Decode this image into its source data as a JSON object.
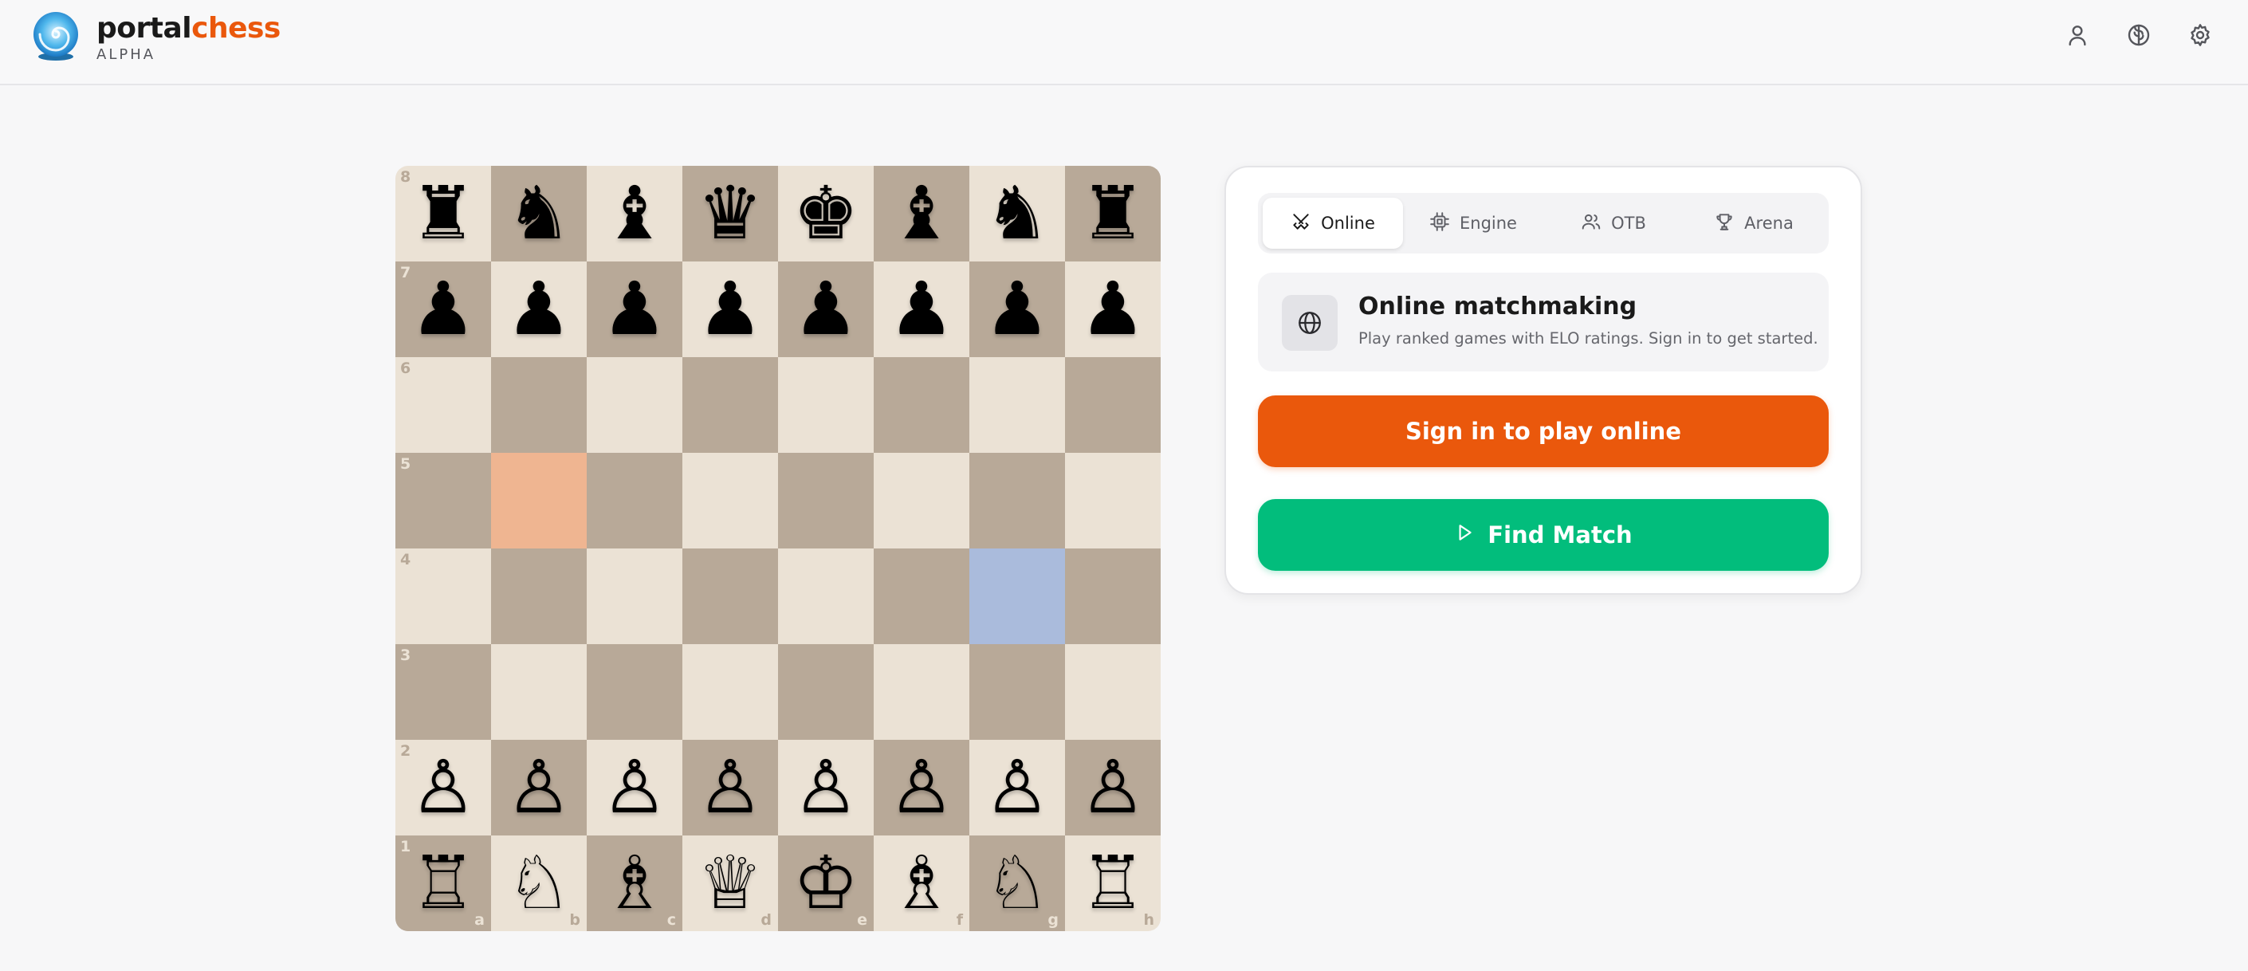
{
  "app": {
    "brand_part1": "portal",
    "brand_part2": "chess",
    "subtitle": "ALPHA",
    "logo_icon": "spiral-logo-icon",
    "accent_color": "#ea580c"
  },
  "header_icons": [
    {
      "name": "profile-icon"
    },
    {
      "name": "brain-icon"
    },
    {
      "name": "settings-icon"
    }
  ],
  "board": {
    "ranks": [
      "8",
      "7",
      "6",
      "5",
      "4",
      "3",
      "2",
      "1"
    ],
    "files": [
      "a",
      "b",
      "c",
      "d",
      "e",
      "f",
      "g",
      "h"
    ],
    "rows": [
      [
        "♜",
        "♞",
        "♝",
        "♛",
        "♚",
        "♝",
        "♞",
        "♜"
      ],
      [
        "♟",
        "♟",
        "♟",
        "♟",
        "♟",
        "♟",
        "♟",
        "♟"
      ],
      [
        "",
        "",
        "",
        "",
        "",
        "",
        "",
        ""
      ],
      [
        "",
        "",
        "",
        "",
        "",
        "",
        "",
        ""
      ],
      [
        "",
        "",
        "",
        "",
        "",
        "",
        "",
        ""
      ],
      [
        "",
        "",
        "",
        "",
        "",
        "",
        "",
        ""
      ],
      [
        "♙",
        "♙",
        "♙",
        "♙",
        "♙",
        "♙",
        "♙",
        "♙"
      ],
      [
        "♖",
        "♘",
        "♗",
        "♕",
        "♔",
        "♗",
        "♘",
        "♖"
      ]
    ],
    "highlight_orange": "b5",
    "highlight_blue": "g4",
    "light_color": "#ebe2d5",
    "dark_color": "#b8a998"
  },
  "panel": {
    "tabs": [
      {
        "label": "Online",
        "icon": "swords-icon",
        "active": true
      },
      {
        "label": "Engine",
        "icon": "cpu-icon",
        "active": false
      },
      {
        "label": "OTB",
        "icon": "users-icon",
        "active": false
      },
      {
        "label": "Arena",
        "icon": "trophy-icon",
        "active": false
      }
    ],
    "info": {
      "icon": "globe-icon",
      "title": "Online matchmaking",
      "description": "Play ranked games with ELO ratings. Sign in to get started."
    },
    "signin_label": "Sign in to play online",
    "find_match_label": "Find Match",
    "signin_color": "#ea580c",
    "find_match_color": "#02bd7c"
  }
}
